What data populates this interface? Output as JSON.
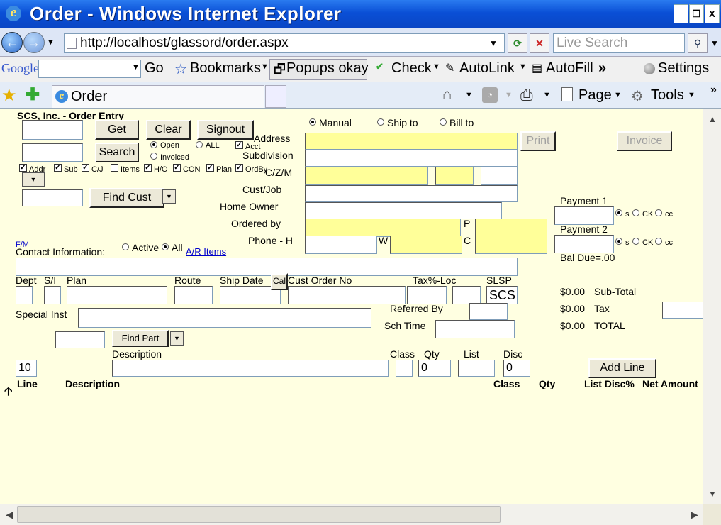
{
  "window": {
    "title": "Order - Windows Internet Explorer",
    "minimize": "_",
    "restore": "❐",
    "close": "X"
  },
  "browser": {
    "back": "←",
    "forward": "→",
    "url": "http://localhost/glassord/order.aspx",
    "search_placeholder": "Live Search",
    "google": {
      "logo": "Google",
      "go": "Go",
      "bookmarks": "Bookmarks",
      "popups": "Popups okay",
      "check": "Check",
      "autolink": "AutoLink",
      "autofill": "AutoFill",
      "more": "»",
      "settings": "Settings"
    },
    "tab_title": "Order",
    "page_menu": "Page",
    "tools_menu": "Tools",
    "more": "»"
  },
  "form": {
    "heading": "SCS, Inc. - Order Entry",
    "buttons": {
      "get": "Get",
      "clear": "Clear",
      "signout": "Signout",
      "search": "Search",
      "find_cust": "Find Cust",
      "print": "Print",
      "invoice": "Invoice",
      "cal": "Cal",
      "find_part": "Find Part",
      "add_line": "Add Line"
    },
    "status_radios": {
      "open": "Open",
      "all": "ALL",
      "acct": "Acct",
      "invoiced": "Invoiced"
    },
    "checkboxes": {
      "addr": "Addr",
      "sub": "Sub",
      "cj": "C/J",
      "items": "Items",
      "ho": "H/O",
      "con": "CON",
      "plan": "Plan",
      "ordby": "OrdBy"
    },
    "ship_radios": {
      "manual": "Manual",
      "ship_to": "Ship to",
      "bill_to": "Bill to"
    },
    "labels": {
      "address": "Address",
      "subdivision": "Subdivision",
      "czm": "C/Z/M",
      "cust_job": "Cust/Job",
      "home_owner": "Home Owner",
      "ordered_by": "Ordered by",
      "p": "P",
      "phone_h": "Phone - H",
      "w": "W",
      "c": "C",
      "fm": "F/M",
      "contact_info": "Contact Information:",
      "active": "Active",
      "all": "All",
      "ar_items": "A/R Items",
      "dept": "Dept",
      "si": "S/I",
      "plan": "Plan",
      "route": "Route",
      "ship_date": "Ship Date",
      "cust_order_no": "Cust Order No",
      "tax_loc": "Tax%-Loc",
      "slsp": "SLSP",
      "special_inst": "Special Inst",
      "referred_by": "Referred By",
      "sch_time": "Sch Time",
      "description": "Description",
      "class": "Class",
      "qty": "Qty",
      "list": "List",
      "disc": "Disc"
    },
    "values": {
      "slsp": "SCS",
      "line_no": "10",
      "qty": "0",
      "disc": "0"
    },
    "payments": {
      "payment1": "Payment 1",
      "payment2": "Payment 2",
      "s": "s",
      "ck": "CK",
      "cc": "cc",
      "bal_due": "Bal Due=.00"
    },
    "totals": {
      "subtotal_amount": "$0.00",
      "subtotal_label": "Sub-Total",
      "tax_amount": "$0.00",
      "tax_label": "Tax",
      "total_amount": "$0.00",
      "total_label": "TOTAL"
    },
    "grid_headers": {
      "line": "Line",
      "description": "Description",
      "class": "Class",
      "qty": "Qty",
      "list_disc": "List Disc%",
      "net_amount": "Net Amount"
    }
  }
}
